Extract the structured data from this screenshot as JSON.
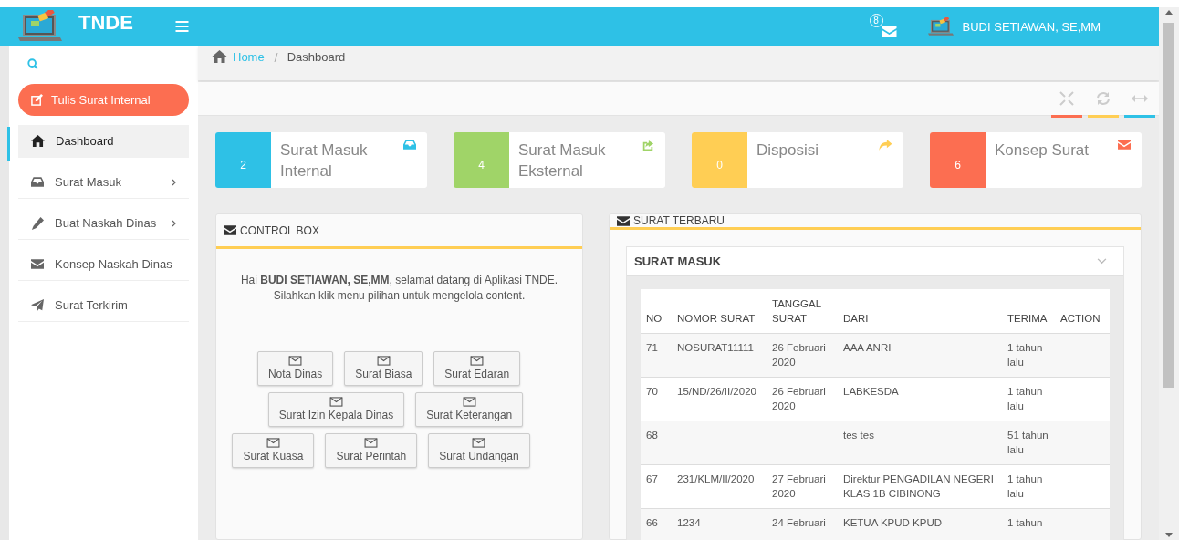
{
  "header": {
    "logo_text": "TNDE",
    "notification_count": "8",
    "user_name": "BUDI SETIAWAN, SE,MM"
  },
  "sidebar": {
    "compose_button": "Tulis Surat Internal",
    "items": [
      {
        "label": "Dashboard",
        "has_submenu": false,
        "selected": true
      },
      {
        "label": "Surat Masuk",
        "has_submenu": true,
        "selected": false
      },
      {
        "label": "Buat Naskah Dinas",
        "has_submenu": true,
        "selected": false
      },
      {
        "label": "Konsep Naskah Dinas",
        "has_submenu": false,
        "selected": false
      },
      {
        "label": "Surat Terkirim",
        "has_submenu": false,
        "selected": false
      }
    ]
  },
  "breadcrumb": [
    "Home",
    "Dashboard"
  ],
  "toolbar_tools": [
    {
      "kind": "expand",
      "color": "#fc6e51"
    },
    {
      "kind": "refresh",
      "color": "#ffce54"
    },
    {
      "kind": "collapse",
      "color": "#2ec1e6"
    }
  ],
  "info_boxes": [
    {
      "count": "2",
      "title": "Surat Masuk Internal",
      "color": "#2ec1e6"
    },
    {
      "count": "4",
      "title": "Surat Masuk Eksternal",
      "color": "#a0d468"
    },
    {
      "count": "0",
      "title": "Disposisi",
      "color": "#ffce54"
    },
    {
      "count": "6",
      "title": "Konsep Surat",
      "color": "#fc6e51"
    }
  ],
  "control_box": {
    "title": "CONTROL BOX",
    "greeting": "Hai **BUDI SETIAWAN, SE,MM**, selamat datang di Aplikasi TNDE.",
    "instruction": "Silahkan klik menu pilihan untuk mengelola content.",
    "button_rows": [
      [
        "Nota Dinas",
        "Surat Biasa",
        "Surat Edaran"
      ],
      [
        "Surat Izin Kepala Dinas",
        "Surat Keterangan"
      ],
      [
        "Surat Kuasa",
        "Surat Perintah",
        "Surat Undangan"
      ]
    ]
  },
  "latest_panel": {
    "title": "SURAT TERBARU",
    "section_title": "SURAT MASUK",
    "table": {
      "columns": [
        "NO",
        "NOMOR SURAT",
        "TANGGAL SURAT",
        "DARI",
        "TERIMA",
        "ACTION"
      ],
      "rows": [
        [
          "71",
          "NOSURAT11111",
          "26 Februari 2020",
          "AAA ANRI",
          "1 tahun lalu",
          ""
        ],
        [
          "70",
          "15/ND/26/II/2020",
          "26 Februari 2020",
          "LABKESDA",
          "1 tahun lalu",
          ""
        ],
        [
          "68",
          "",
          "",
          "tes tes",
          "51 tahun lalu",
          ""
        ],
        [
          "67",
          "231/KLM/II/2020",
          "27 Februari 2020",
          "Direktur PENGADILAN NEGERI KLAS 1B CIBINONG",
          "1 tahun lalu",
          ""
        ],
        [
          "66",
          "1234",
          "24 Februari",
          "KETUA KPUD KPUD",
          "1 tahun",
          ""
        ]
      ]
    }
  }
}
